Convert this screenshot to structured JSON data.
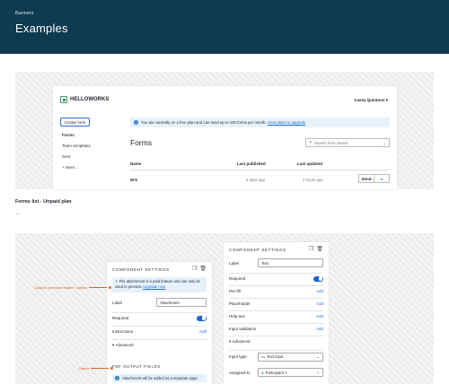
{
  "header": {
    "breadcrumb": "Banners",
    "title": "Examples"
  },
  "app": {
    "logo": "HELLOWORKS",
    "user": "Casey Quintons",
    "create_form": "Create form",
    "sidebar": [
      "Forms",
      "Team templates",
      "Sent",
      "+ More..."
    ],
    "banner": {
      "text": "You are currently on a free plan and can send up to 100 forms per month.",
      "link": "View plans to upgrade"
    },
    "forms_title": "Forms",
    "search_placeholder": "Search form names",
    "columns": [
      "Name",
      "Last published",
      "Last updated"
    ],
    "rows": [
      {
        "name": "W-9",
        "published": "4 days ago",
        "updated": "2 hours ago",
        "action": "Send"
      }
    ]
  },
  "caption": "Forms list - Unpaid plan",
  "caption_sub": "—",
  "panel1": {
    "title": "COMPONENT SETTINGS",
    "upgrade_text": "File attachment is a paid feature and can only be used in preview.",
    "upgrade_link": "Upgrade now",
    "label": "Label",
    "label_value": "Attachment",
    "required": "Required",
    "instructions": "Instructions",
    "add": "Add",
    "advanced": "Advanced",
    "pdf_title": "PDF OUTPUT FIELDS",
    "notice": "Attachment will be added as a separate page"
  },
  "panel2": {
    "title": "COMPONENT SETTINGS",
    "label": "Label",
    "label_value": "Text",
    "required": "Required",
    "prefill": "Pre-fill",
    "placeholder": "Placeholder",
    "help_text": "Help text",
    "input_validation": "Input validation",
    "add": "Add",
    "advanced": "Advanced",
    "input_type": "Input type",
    "input_type_value": "Text input",
    "assigned_to": "Assigned to",
    "assigned_value": "Participant 1"
  },
  "annotations": {
    "custom": "Custom 'premium feature' variant",
    "native": "Native"
  },
  "colors": {
    "header": "#103a4f",
    "accent": "#2b6dd6",
    "annotation": "#e0612a"
  }
}
